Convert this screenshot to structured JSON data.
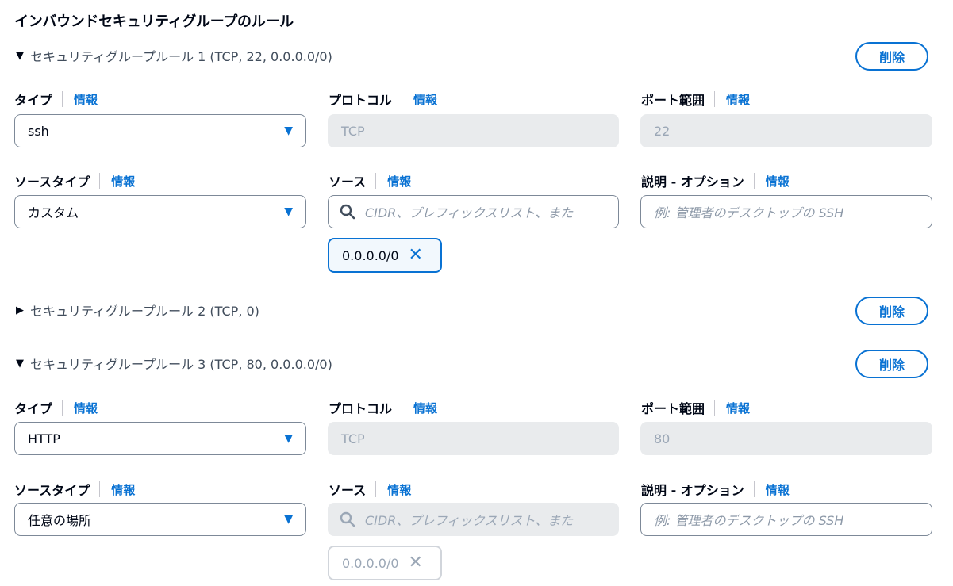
{
  "section_title": "インバウンドセキュリティグループのルール",
  "delete_label": "削除",
  "info_label": "情報",
  "labels": {
    "type": "タイプ",
    "protocol": "プロトコル",
    "port_range": "ポート範囲",
    "source_type": "ソースタイプ",
    "source": "ソース",
    "description": "説明 - オプション"
  },
  "search_placeholder": "CIDR、プレフィックスリスト、また",
  "description_placeholder": "例: 管理者のデスクトップの SSH",
  "icons": {
    "expanded": "caret-down-icon",
    "collapsed": "caret-right-icon",
    "select_arrow": "triangle-down-icon",
    "search": "search-icon",
    "remove": "close-icon"
  },
  "colors": {
    "accent": "#0972d3",
    "disabled_bg": "#e9ebed"
  },
  "rules": [
    {
      "title": "セキュリティグループルール 1 (TCP, 22, 0.0.0.0/0)",
      "expanded": true,
      "type": "ssh",
      "protocol": "TCP",
      "port": "22",
      "source_type": "カスタム",
      "source_token": "0.0.0.0/0"
    },
    {
      "title": "セキュリティグループルール 2 (TCP, 0)",
      "expanded": false
    },
    {
      "title": "セキュリティグループルール 3 (TCP, 80, 0.0.0.0/0)",
      "expanded": true,
      "type": "HTTP",
      "protocol": "TCP",
      "port": "80",
      "source_type": "任意の場所",
      "source_token": "0.0.0.0/0"
    }
  ]
}
